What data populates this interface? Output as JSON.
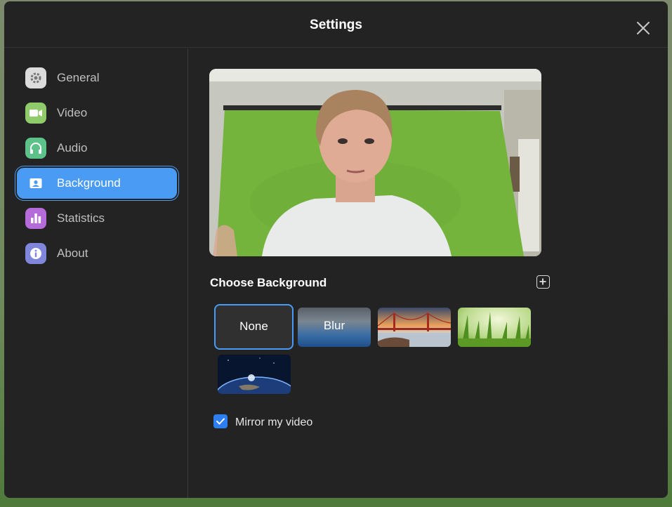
{
  "window": {
    "title": "Settings"
  },
  "sidebar": {
    "items": [
      {
        "label": "General",
        "icon": "gear-icon",
        "color": "#dcdcdc",
        "active": false
      },
      {
        "label": "Video",
        "icon": "video-camera-icon",
        "color": "#8fcb6a",
        "active": false
      },
      {
        "label": "Audio",
        "icon": "headphones-icon",
        "color": "#5cc28a",
        "active": false
      },
      {
        "label": "Background",
        "icon": "portrait-icon",
        "color": "#4a9bf4",
        "active": true
      },
      {
        "label": "Statistics",
        "icon": "bar-chart-icon",
        "color": "#b56bd9",
        "active": false
      },
      {
        "label": "About",
        "icon": "info-icon",
        "color": "#7f86dc",
        "active": false
      }
    ]
  },
  "background": {
    "section_title": "Choose Background",
    "options": [
      {
        "label": "None",
        "selected": true
      },
      {
        "label": "Blur",
        "selected": false
      },
      {
        "label": "",
        "name": "golden-gate-bridge",
        "selected": false
      },
      {
        "label": "",
        "name": "grass",
        "selected": false
      },
      {
        "label": "",
        "name": "earth-from-space",
        "selected": false
      }
    ],
    "mirror_label": "Mirror my video",
    "mirror_checked": true
  },
  "colors": {
    "accent": "#4a9bf4",
    "window_bg": "#232323",
    "checkbox": "#2d7ff0"
  }
}
